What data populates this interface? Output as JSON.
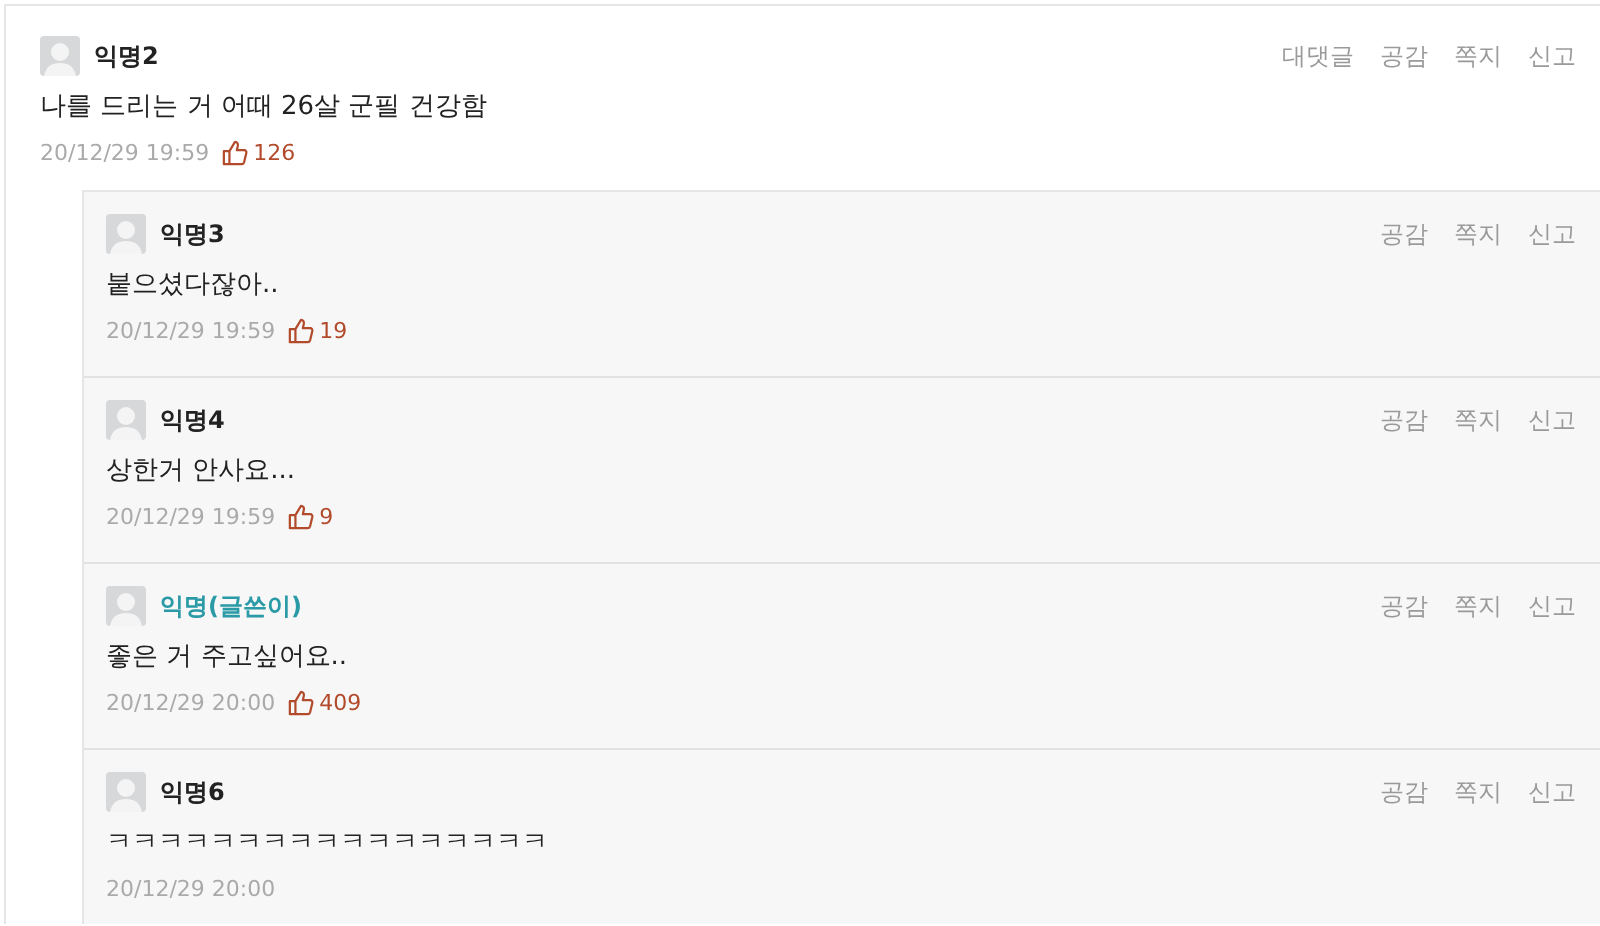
{
  "comments": [
    {
      "author": "익명2",
      "is_writer": false,
      "text": "나를 드리는 거 어때 26살 군필 건강함",
      "time": "20/12/29 19:59",
      "likes": "126",
      "actions": [
        "대댓글",
        "공감",
        "쪽지",
        "신고"
      ]
    }
  ],
  "replies": [
    {
      "author": "익명3",
      "is_writer": false,
      "text": "붙으셨다잖아..",
      "time": "20/12/29 19:59",
      "likes": "19",
      "actions": [
        "공감",
        "쪽지",
        "신고"
      ]
    },
    {
      "author": "익명4",
      "is_writer": false,
      "text": "상한거 안사요...",
      "time": "20/12/29 19:59",
      "likes": "9",
      "actions": [
        "공감",
        "쪽지",
        "신고"
      ]
    },
    {
      "author": "익명(글쓴이)",
      "is_writer": true,
      "text": "좋은 거 주고싶어요..",
      "time": "20/12/29 20:00",
      "likes": "409",
      "actions": [
        "공감",
        "쪽지",
        "신고"
      ]
    },
    {
      "author": "익명6",
      "is_writer": false,
      "text": "ㅋㅋㅋㅋㅋㅋㅋㅋㅋㅋㅋㅋㅋㅋㅋㅋㅋ",
      "time": "20/12/29 20:00",
      "actions": [
        "공감",
        "쪽지",
        "신고"
      ]
    }
  ]
}
